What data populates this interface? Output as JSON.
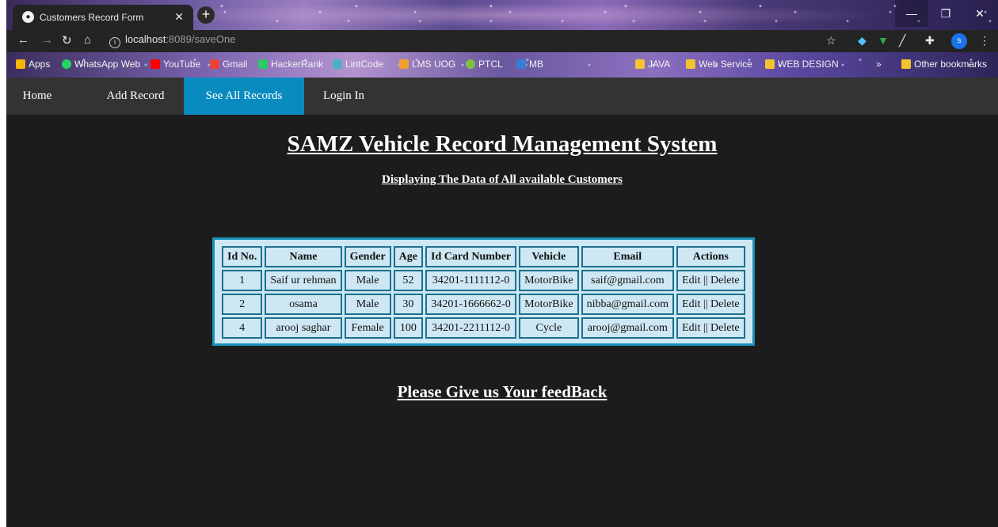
{
  "browser": {
    "tab_title": "Customers Record Form",
    "url_host": "localhost",
    "url_path": ":8089/saveOne",
    "bookmarks": [
      {
        "label": "Apps",
        "color": "#f4b400"
      },
      {
        "label": "WhatsApp Web",
        "color": "#25d366"
      },
      {
        "label": "YouTube",
        "color": "#ff0000"
      },
      {
        "label": "Gmail",
        "color": "#ea4335"
      },
      {
        "label": "HackerRank",
        "color": "#2ec866"
      },
      {
        "label": "LintCode",
        "color": "#4fb0c6"
      },
      {
        "label": "LMS UOG",
        "color": "#f0a030"
      },
      {
        "label": "PTCL",
        "color": "#80c040"
      },
      {
        "label": "MB",
        "color": "#3a7bd5"
      },
      {
        "label": "JAVA",
        "color": "#f4c430"
      },
      {
        "label": "Web Service",
        "color": "#f4c430"
      },
      {
        "label": "WEB DESIGN",
        "color": "#f4c430"
      }
    ],
    "other_bookmarks": "Other bookmarks",
    "profile_initial": "s"
  },
  "nav": {
    "items": [
      "Home",
      "Add Record",
      "See All Records",
      "Login In"
    ],
    "active": "See All Records",
    "active_color": "#0a8bbf"
  },
  "page": {
    "title": "SAMZ Vehicle Record Management System",
    "subtitle": "Displaying The Data of All available Customers",
    "feedback": "Please Give us Your feedBack"
  },
  "table": {
    "headers": [
      "Id No.",
      "Name",
      "Gender",
      "Age",
      "Id Card Number",
      "Vehicle",
      "Email",
      "Actions"
    ],
    "rows": [
      [
        "1",
        "Saif ur rehman",
        "Male",
        "52",
        "34201-1111112-0",
        "MotorBike",
        "saif@gmail.com"
      ],
      [
        "2",
        "osama",
        "Male",
        "30",
        "34201-1666662-0",
        "MotorBike",
        "nibba@gmail.com"
      ],
      [
        "4",
        "arooj saghar",
        "Female",
        "100",
        "34201-2211112-0",
        "Cycle",
        "arooj@gmail.com"
      ]
    ],
    "edit_label": "Edit",
    "separator": "||",
    "delete_label": "Delete"
  }
}
